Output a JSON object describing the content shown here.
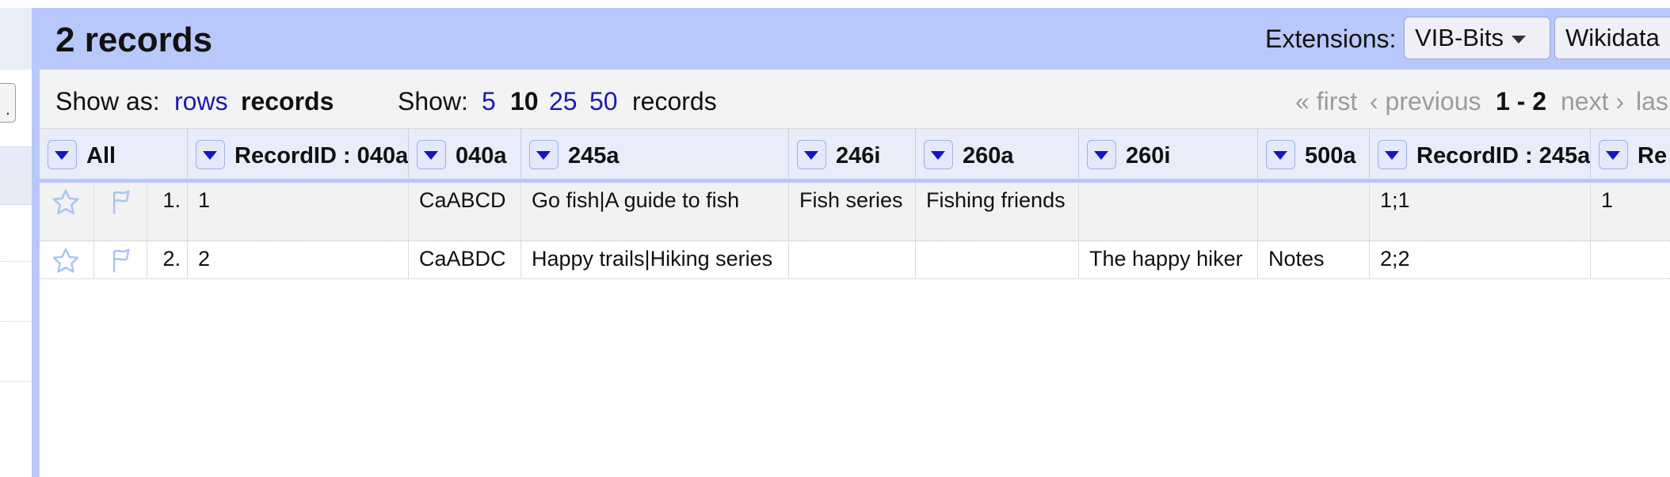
{
  "header": {
    "title": "2 records",
    "extensions_label": "Extensions:",
    "extensions": [
      "VIB-Bits",
      "Wikidata"
    ]
  },
  "toolbar": {
    "show_as_label": "Show as:",
    "show_as_rows": "rows",
    "show_as_records": "records",
    "show_label": "Show:",
    "page_sizes": [
      "5",
      "10",
      "25",
      "50"
    ],
    "selected_page_size": "10",
    "show_suffix": "records",
    "pager": {
      "first": "« first",
      "previous": "‹ previous",
      "range": "1 - 2",
      "next": "next ›",
      "last": "las"
    }
  },
  "columns": [
    {
      "label": "All"
    },
    {
      "label": "RecordID : 040a"
    },
    {
      "label": "040a"
    },
    {
      "label": "245a"
    },
    {
      "label": "246i"
    },
    {
      "label": "260a"
    },
    {
      "label": "260i"
    },
    {
      "label": "500a"
    },
    {
      "label": "RecordID : 245a"
    },
    {
      "label": "Re"
    }
  ],
  "rows": [
    {
      "index": "1.",
      "cells": [
        "1",
        "CaABCD",
        "Go fish|A guide to fish",
        "Fish series",
        "Fishing friends",
        "",
        "",
        "1;1",
        "1"
      ]
    },
    {
      "index": "2.",
      "cells": [
        "2",
        "CaABDC",
        "Happy trails|Hiking series",
        "",
        "",
        "The happy hiker",
        "Notes",
        "2;2",
        ""
      ]
    }
  ],
  "icons": {
    "star": "star-icon",
    "flag": "flag-icon",
    "dropdown": "dropdown-triangle-icon"
  },
  "colors": {
    "header_blue": "#b9c8fa",
    "column_header_bg": "#e8edf9",
    "link": "#1a1ab3",
    "disabled": "#9c9c9c"
  }
}
